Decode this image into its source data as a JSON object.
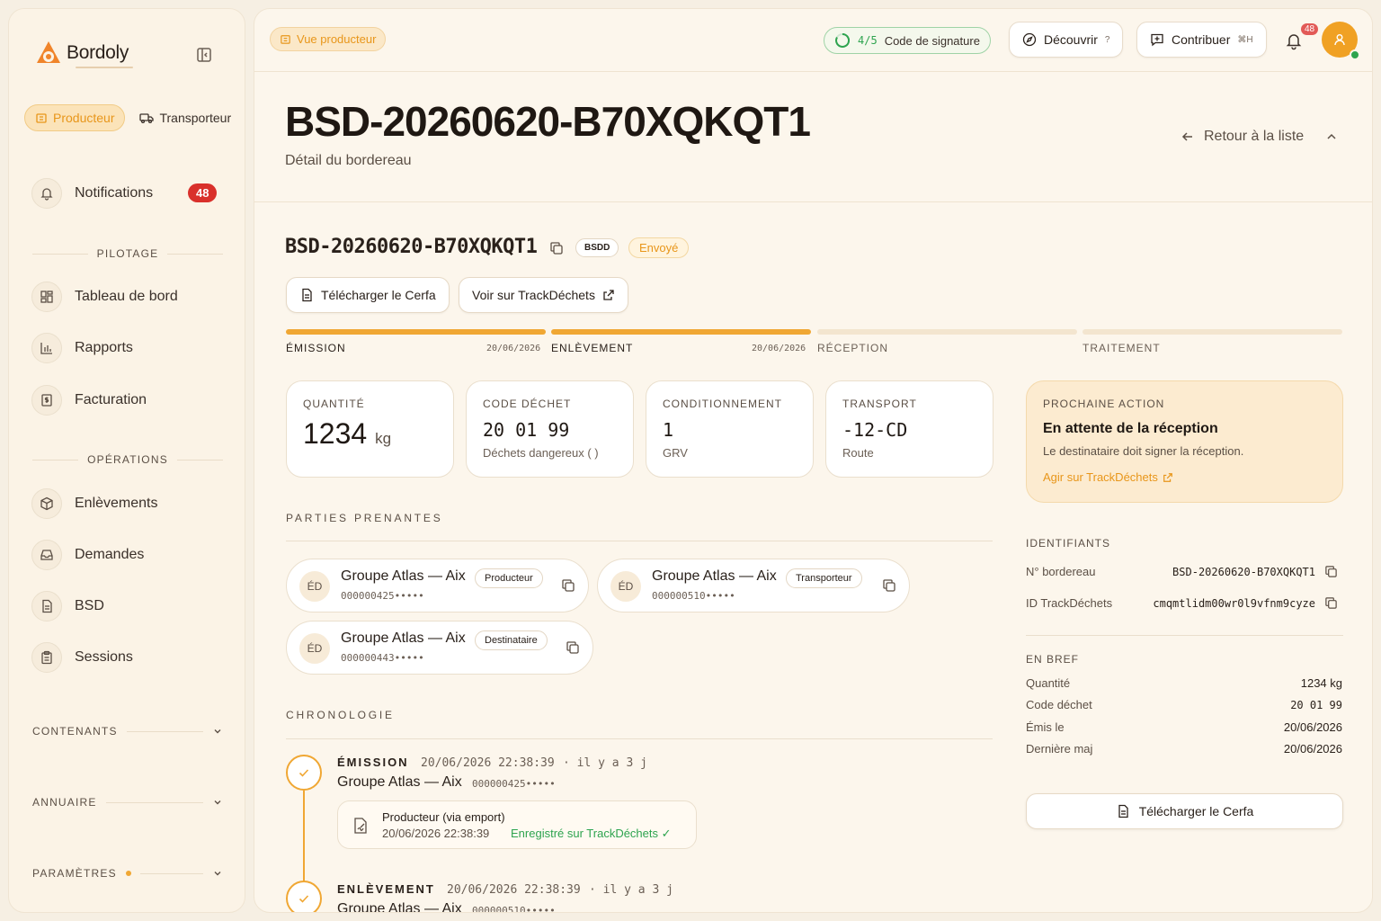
{
  "sidebar": {
    "logo_text": "Bordoly",
    "roles": [
      {
        "label": "Producteur"
      },
      {
        "label": "Transporteur"
      }
    ],
    "notifications": {
      "label": "Notifications",
      "count": "48"
    },
    "pilotage_label": "PILOTAGE",
    "pilotage_items": [
      {
        "label": "Tableau de bord"
      },
      {
        "label": "Rapports"
      },
      {
        "label": "Facturation"
      }
    ],
    "operations_label": "OPÉRATIONS",
    "operations_items": [
      {
        "label": "Enlèvements"
      },
      {
        "label": "Demandes"
      },
      {
        "label": "BSD"
      },
      {
        "label": "Sessions"
      }
    ],
    "groups": [
      {
        "label": "CONTENANTS"
      },
      {
        "label": "ANNUAIRE"
      },
      {
        "label": "PARAMÈTRES"
      }
    ]
  },
  "topbar": {
    "view_chip": "Vue producteur",
    "signature": {
      "progress": "4/5",
      "label": "Code de signature"
    },
    "discover": {
      "label": "Découvrir",
      "shortcut": "?"
    },
    "contribute": {
      "label": "Contribuer",
      "shortcut": "⌘H"
    },
    "notif_count": "48"
  },
  "header": {
    "title": "BSD-20260620-B70XQKQT1",
    "subtitle": "Détail du bordereau",
    "back_label": "Retour à la liste"
  },
  "bsd": {
    "id": "BSD-20260620-B70XQKQT1",
    "type_tag": "BSDD",
    "status": "Envoyé",
    "download_label": "Télécharger le Cerfa",
    "trackdechets_label": "Voir sur TrackDéchets"
  },
  "steps": [
    {
      "label": "ÉMISSION",
      "date": "20/06/2026",
      "done": true
    },
    {
      "label": "ENLÈVEMENT",
      "date": "20/06/2026",
      "done": true
    },
    {
      "label": "RÉCEPTION",
      "date": "",
      "done": false
    },
    {
      "label": "TRAITEMENT",
      "date": "",
      "done": false
    }
  ],
  "cards": [
    {
      "label": "QUANTITÉ",
      "value": "1234",
      "unit": "kg",
      "sub": ""
    },
    {
      "label": "CODE DÉCHET",
      "value": "20 01 99",
      "sub": "Déchets dangereux ( )"
    },
    {
      "label": "CONDITIONNEMENT",
      "value": "1",
      "sub": "GRV"
    },
    {
      "label": "TRANSPORT",
      "value": "-12-CD",
      "sub": "Route"
    }
  ],
  "next_action": {
    "label": "PROCHAINE ACTION",
    "title": "En attente de la réception",
    "text": "Le destinataire doit signer la réception.",
    "link": "Agir sur TrackDéchets"
  },
  "parties": {
    "heading": "PARTIES PRENANTES",
    "items": [
      {
        "initials": "ÉD",
        "name": "Groupe Atlas — Aix",
        "role": "Producteur",
        "siret": "000000425•••••"
      },
      {
        "initials": "ÉD",
        "name": "Groupe Atlas — Aix",
        "role": "Transporteur",
        "siret": "000000510•••••"
      },
      {
        "initials": "ÉD",
        "name": "Groupe Atlas — Aix",
        "role": "Destinataire",
        "siret": "000000443•••••"
      }
    ]
  },
  "timeline": {
    "heading": "CHRONOLOGIE",
    "events": [
      {
        "step": "ÉMISSION",
        "datetime": "20/06/2026 22:38:39",
        "ago": "· il y a 3 j",
        "org": "Groupe Atlas — Aix",
        "siret": "000000425•••••",
        "detail": {
          "title": "Producteur (via emport)",
          "datetime": "20/06/2026 22:38:39",
          "status": "Enregistré sur TrackDéchets ✓"
        }
      },
      {
        "step": "ENLÈVEMENT",
        "datetime": "20/06/2026 22:38:39",
        "ago": "· il y a 3 j",
        "org": "Groupe Atlas — Aix",
        "siret": "000000510•••••"
      }
    ]
  },
  "identifiers": {
    "heading": "IDENTIFIANTS",
    "rows": [
      {
        "label": "N° bordereau",
        "value": "BSD-20260620-B70XQKQT1"
      },
      {
        "label": "ID TrackDéchets",
        "value": "cmqmtlidm00wr0l9vfnm9cyze"
      }
    ]
  },
  "summary": {
    "heading": "EN BREF",
    "rows": [
      {
        "label": "Quantité",
        "value": "1234 kg"
      },
      {
        "label": "Code déchet",
        "value": "20 01 99"
      },
      {
        "label": "Émis le",
        "value": "20/06/2026"
      },
      {
        "label": "Dernière maj",
        "value": "20/06/2026"
      }
    ],
    "download_label": "Télécharger le Cerfa"
  },
  "colors": {
    "accent": "#f0a733",
    "accent_text": "#e8961a",
    "danger": "#d9302b",
    "success": "#2ea44f"
  }
}
